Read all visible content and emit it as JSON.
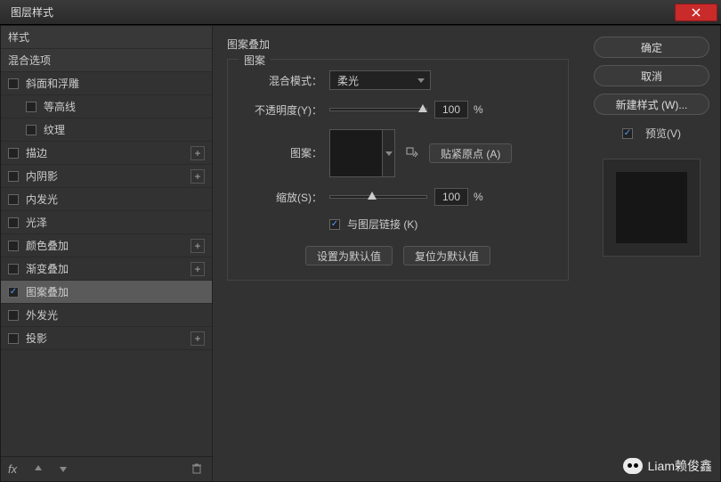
{
  "title": "图层样式",
  "sidebar": {
    "items": [
      {
        "label": "样式",
        "header": true
      },
      {
        "label": "混合选项",
        "header": true
      },
      {
        "label": "斜面和浮雕",
        "checkbox": true
      },
      {
        "label": "等高线",
        "checkbox": true,
        "indent": true
      },
      {
        "label": "纹理",
        "checkbox": true,
        "indent": true
      },
      {
        "label": "描边",
        "checkbox": true,
        "plus": true
      },
      {
        "label": "内阴影",
        "checkbox": true,
        "plus": true
      },
      {
        "label": "内发光",
        "checkbox": true
      },
      {
        "label": "光泽",
        "checkbox": true
      },
      {
        "label": "颜色叠加",
        "checkbox": true,
        "plus": true
      },
      {
        "label": "渐变叠加",
        "checkbox": true,
        "plus": true
      },
      {
        "label": "图案叠加",
        "checkbox": true,
        "checked": true,
        "selected": true
      },
      {
        "label": "外发光",
        "checkbox": true
      },
      {
        "label": "投影",
        "checkbox": true,
        "plus": true
      }
    ]
  },
  "main": {
    "title": "图案叠加",
    "legend": "图案",
    "blendMode": {
      "label": "混合模式：",
      "value": "柔光"
    },
    "opacity": {
      "label": "不透明度(Y)：",
      "value": "100",
      "unit": "%",
      "pos": 100
    },
    "pattern": {
      "label": "图案：",
      "snapBtn": "贴紧原点 (A)"
    },
    "scale": {
      "label": "缩放(S)：",
      "value": "100",
      "unit": "%",
      "pos": 40
    },
    "linkLayer": {
      "label": "与图层链接 (K)",
      "checked": true
    },
    "setDefault": "设置为默认值",
    "resetDefault": "复位为默认值"
  },
  "right": {
    "ok": "确定",
    "cancel": "取消",
    "newStyle": "新建样式 (W)...",
    "preview": {
      "label": "预览(V)",
      "checked": true
    }
  },
  "watermark": "Liam赖俊鑫"
}
